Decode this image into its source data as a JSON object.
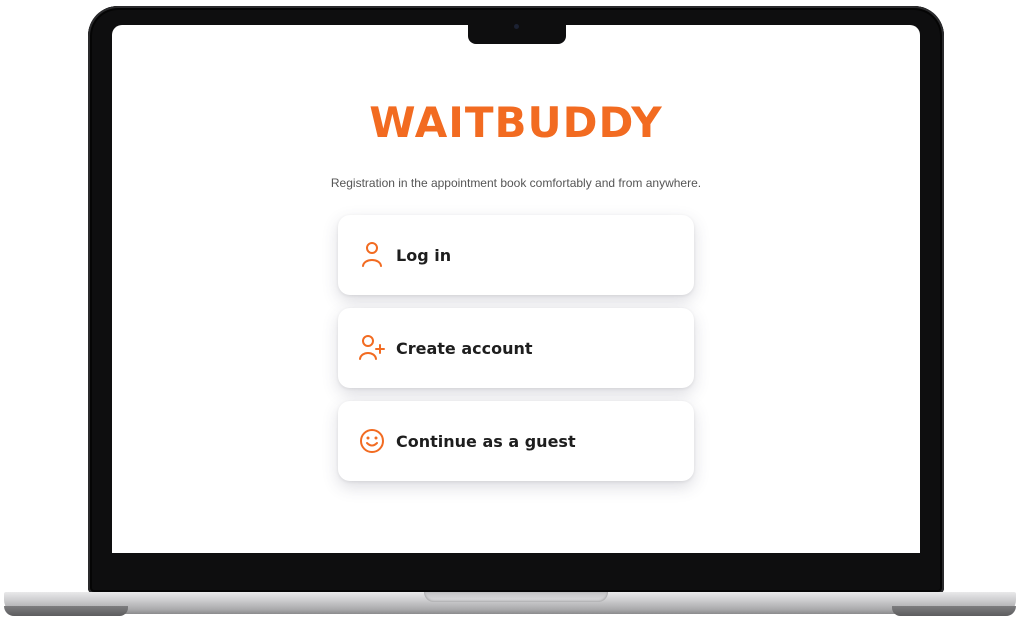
{
  "app": {
    "brand": "WAITBUDDY",
    "tagline": "Registration in the appointment book comfortably and from anywhere."
  },
  "options": [
    {
      "label": "Log in",
      "icon": "user-icon"
    },
    {
      "label": "Create account",
      "icon": "user-plus-icon"
    },
    {
      "label": "Continue as a guest",
      "icon": "smiley-icon"
    }
  ],
  "colors": {
    "accent": "#f26b21",
    "text": "#1e1e1e",
    "subtext": "#555555"
  }
}
